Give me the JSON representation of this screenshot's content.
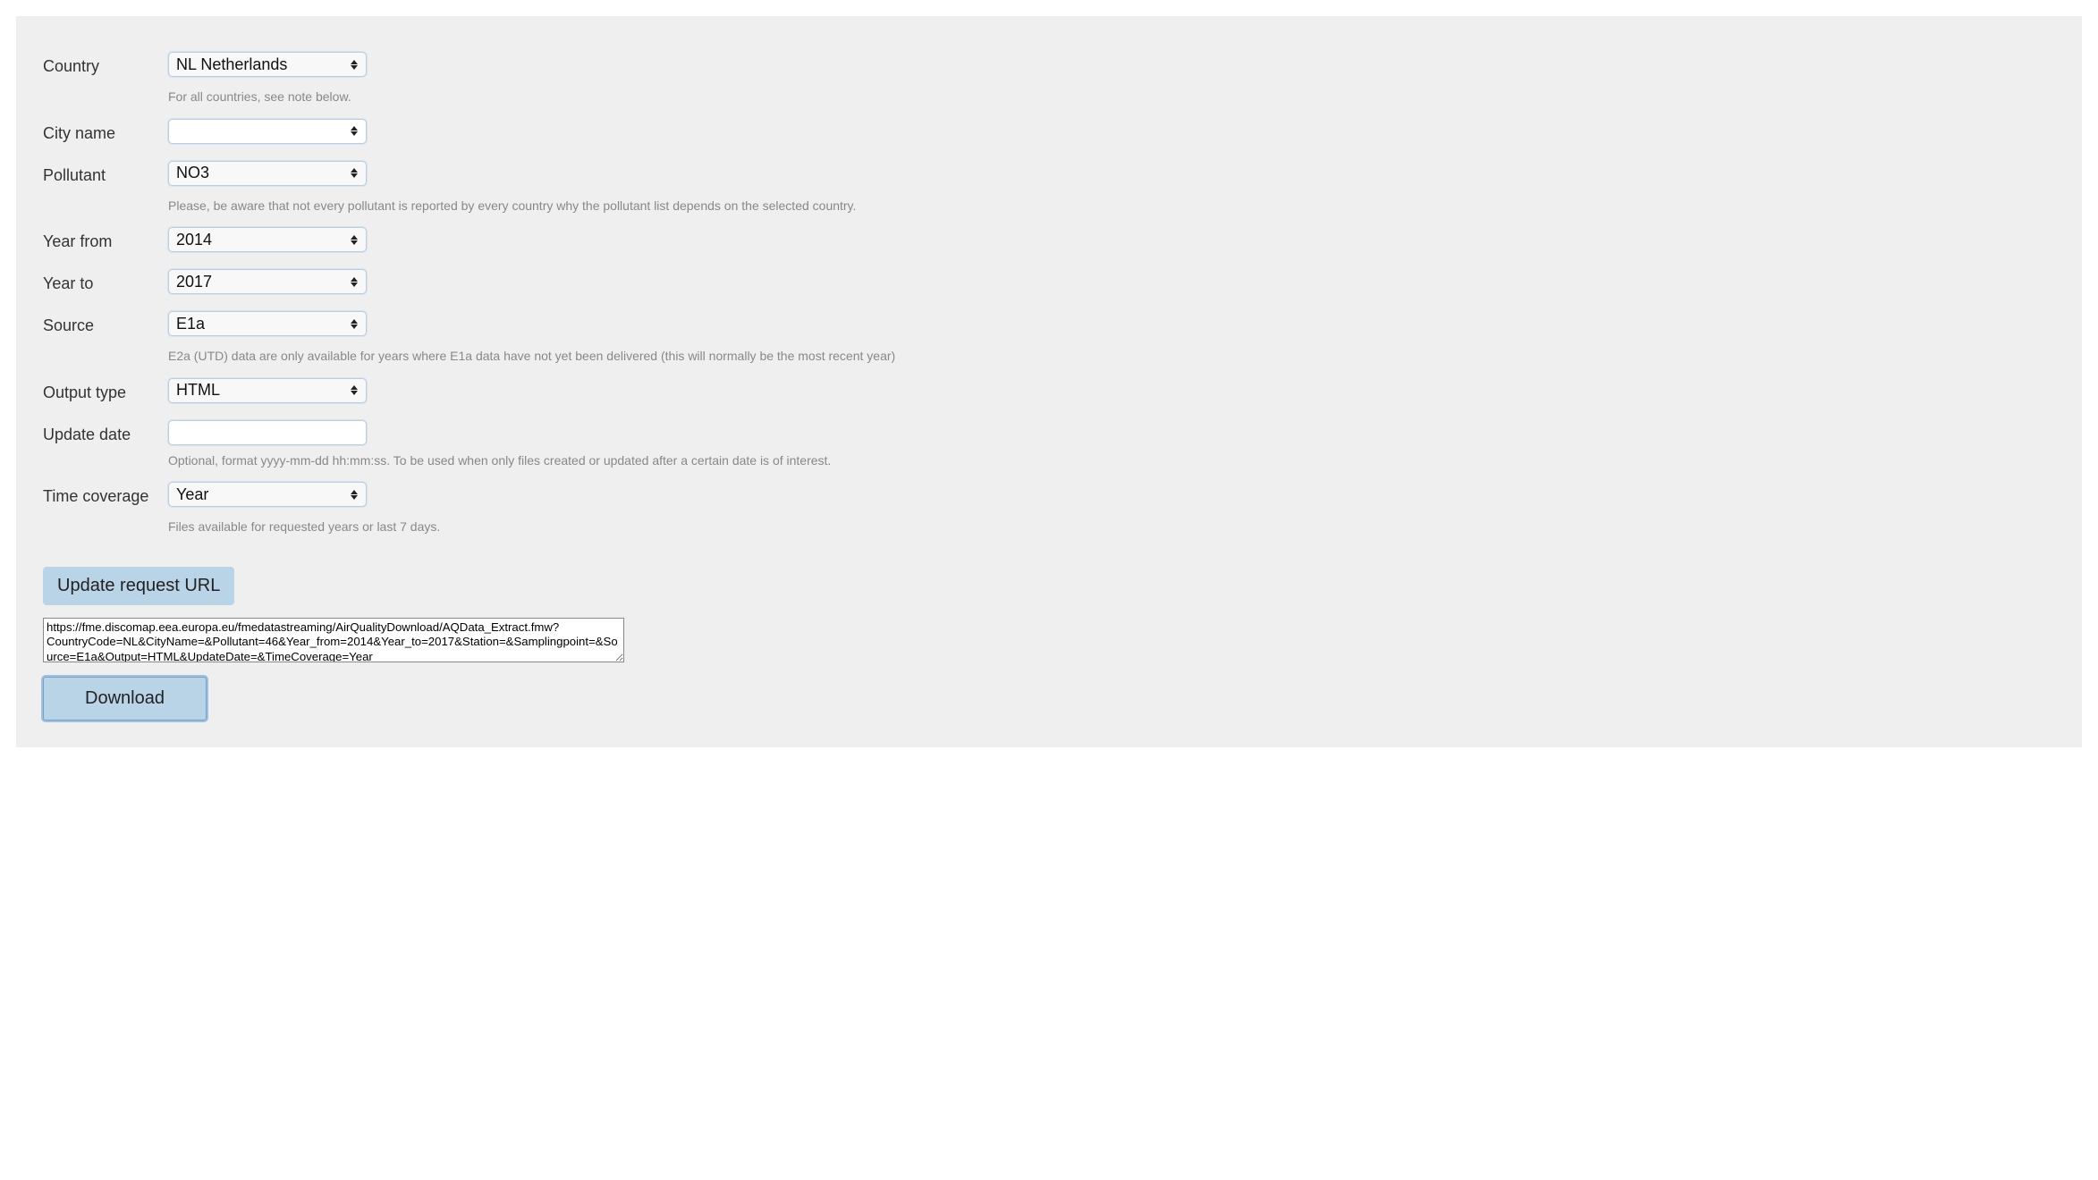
{
  "fields": {
    "country": {
      "label": "Country",
      "value": "NL Netherlands",
      "hint": "For all countries, see note below."
    },
    "city": {
      "label": "City name",
      "value": ""
    },
    "pollutant": {
      "label": "Pollutant",
      "value": "NO3",
      "hint": "Please, be aware that not every pollutant is reported by every country why the pollutant list depends on the selected country."
    },
    "year_from": {
      "label": "Year from",
      "value": "2014"
    },
    "year_to": {
      "label": "Year to",
      "value": "2017"
    },
    "source": {
      "label": "Source",
      "value": "E1a",
      "hint": "E2a (UTD) data are only available for years where E1a data have not yet been delivered (this will normally be the most recent year)"
    },
    "output": {
      "label": "Output type",
      "value": "HTML"
    },
    "update_date": {
      "label": "Update date",
      "value": "",
      "hint": "Optional, format yyyy-mm-dd hh:mm:ss. To be used when only files created or updated after a certain date is of interest."
    },
    "coverage": {
      "label": "Time coverage",
      "value": "Year",
      "hint": "Files available for requested years or last 7 days."
    }
  },
  "buttons": {
    "update": "Update request URL",
    "download": "Download"
  },
  "url": "https://fme.discomap.eea.europa.eu/fmedatastreaming/AirQualityDownload/AQData_Extract.fmw?CountryCode=NL&CityName=&Pollutant=46&Year_from=2014&Year_to=2017&Station=&Samplingpoint=&Source=E1a&Output=HTML&UpdateDate=&TimeCoverage=Year"
}
